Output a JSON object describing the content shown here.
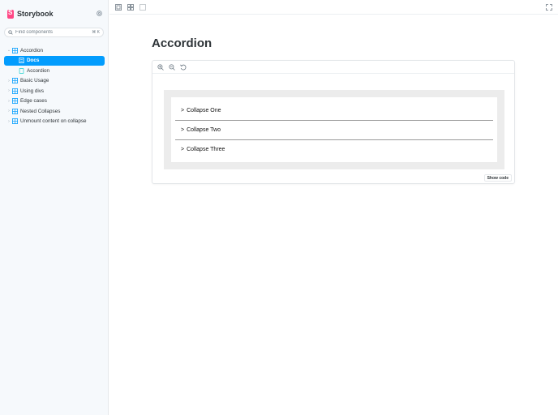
{
  "brand": {
    "name": "Storybook"
  },
  "search": {
    "placeholder": "Find components",
    "shortcut": "⌘ K"
  },
  "sidebar": {
    "items": [
      {
        "label": "Accordion",
        "icon": "component-icon",
        "expanded": true
      },
      {
        "label": "Docs",
        "icon": "doc-icon",
        "active": true,
        "child": true
      },
      {
        "label": "Accordion",
        "icon": "story-icon",
        "child": true
      },
      {
        "label": "Basic Usage",
        "icon": "component-icon"
      },
      {
        "label": "Using divs",
        "icon": "component-icon"
      },
      {
        "label": "Edge cases",
        "icon": "component-icon"
      },
      {
        "label": "Nested Collapses",
        "icon": "component-icon"
      },
      {
        "label": "Unmount content on collapse",
        "icon": "component-icon"
      }
    ]
  },
  "toolbar": {
    "icons": [
      "sidebar-toggle-icon",
      "grid-icon",
      "outline-icon",
      "fullscreen-icon"
    ]
  },
  "main": {
    "title": "Accordion",
    "preview": {
      "tools": [
        "zoom-in-icon",
        "zoom-out-icon",
        "zoom-reset-icon"
      ],
      "accordion": [
        "Collapse One",
        "Collapse Two",
        "Collapse Three"
      ],
      "arrow": ">",
      "show_code_label": "Show code"
    }
  },
  "colors": {
    "accent": "#029cfd",
    "brand": "#ff4785",
    "sidebar_bg": "#f6f9fc"
  }
}
